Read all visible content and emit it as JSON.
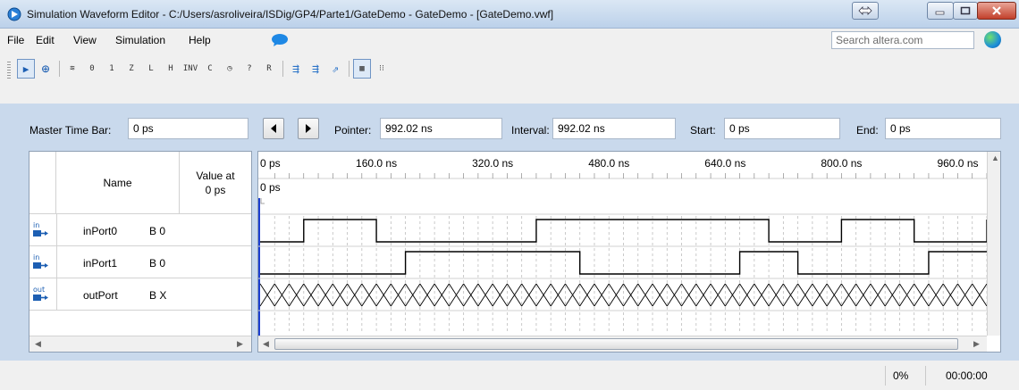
{
  "window": {
    "title": "Simulation Waveform Editor - C:/Users/asroliveira/ISDig/GP4/Parte1/GateDemo - GateDemo - [GateDemo.vwf]"
  },
  "menu": {
    "items": [
      {
        "label": "File"
      },
      {
        "label": "Edit"
      },
      {
        "label": "View"
      },
      {
        "label": "Simulation"
      },
      {
        "label": "Help"
      }
    ],
    "search_placeholder": "Search altera.com"
  },
  "toolbar": {
    "tools": [
      {
        "icon": "pointer-tool-icon",
        "glyph": "▶"
      },
      {
        "icon": "zoom-tool-icon",
        "glyph": "⊕"
      },
      {
        "icon": "unknown-x-icon",
        "glyph": "≋"
      },
      {
        "icon": "forcing-low-icon",
        "glyph": "0"
      },
      {
        "icon": "forcing-high-icon",
        "glyph": "1"
      },
      {
        "icon": "high-impedance-icon",
        "glyph": "Z"
      },
      {
        "icon": "weak-low-icon",
        "glyph": "L"
      },
      {
        "icon": "weak-high-icon",
        "glyph": "H"
      },
      {
        "icon": "invert-icon",
        "glyph": "INV"
      },
      {
        "icon": "count-value-icon",
        "glyph": "C"
      },
      {
        "icon": "overwrite-clock-icon",
        "glyph": "◷"
      },
      {
        "icon": "arbitrary-value-icon",
        "glyph": "?"
      },
      {
        "icon": "random-values-icon",
        "glyph": "R"
      },
      {
        "icon": "run-functional-simulation-icon",
        "glyph": "⇶"
      },
      {
        "icon": "run-timing-simulation-icon",
        "glyph": "⇶"
      },
      {
        "icon": "generate-netlist-icon",
        "glyph": "⇗"
      },
      {
        "icon": "snap-to-grid-icon",
        "glyph": "▦"
      },
      {
        "icon": "grid-settings-icon",
        "glyph": "⁝⁝"
      }
    ]
  },
  "timebar": {
    "master_time_bar_label": "Master Time Bar:",
    "master_time_bar_value": "0 ps",
    "pointer_label": "Pointer:",
    "pointer_value": "992.02 ns",
    "interval_label": "Interval:",
    "interval_value": "992.02 ns",
    "start_label": "Start:",
    "start_value": "0 ps",
    "end_label": "End:",
    "end_value": "0 ps"
  },
  "grid": {
    "col_name": "Name",
    "col_value_line1": "Value at",
    "col_value_line2": "0 ps",
    "signals": [
      {
        "name": "inPort0",
        "value": "B 0",
        "dir": "in",
        "icon": "input-pin-icon"
      },
      {
        "name": "inPort1",
        "value": "B 0",
        "dir": "in",
        "icon": "input-pin-icon"
      },
      {
        "name": "outPort",
        "value": "B X",
        "dir": "out",
        "icon": "output-pin-icon"
      }
    ]
  },
  "waveform": {
    "time_ticks": [
      "0 ps",
      "160.0 ns",
      "320.0 ns",
      "480.0 ns",
      "640.0 ns",
      "800.0 ns",
      "960.0 ns"
    ],
    "time_tick_values_ns": [
      0,
      160,
      320,
      480,
      640,
      800,
      960
    ],
    "cursor_label": "0 ps",
    "visible_range_ns": [
      0,
      1000
    ],
    "traces": [
      {
        "signal": "inPort0",
        "kind": "binary",
        "transitions_ns": [
          0,
          60,
          160,
          380,
          480,
          700,
          800,
          900,
          1000
        ],
        "levels": [
          0,
          1,
          0,
          1,
          1,
          0,
          1,
          0,
          1
        ]
      },
      {
        "signal": "inPort1",
        "kind": "binary",
        "transitions_ns": [
          0,
          200,
          440,
          660,
          740,
          920
        ],
        "levels": [
          0,
          1,
          0,
          1,
          0,
          1
        ]
      },
      {
        "signal": "outPort",
        "kind": "unknown"
      }
    ]
  },
  "status": {
    "progress": "0%",
    "elapsed": "00:00:00"
  }
}
